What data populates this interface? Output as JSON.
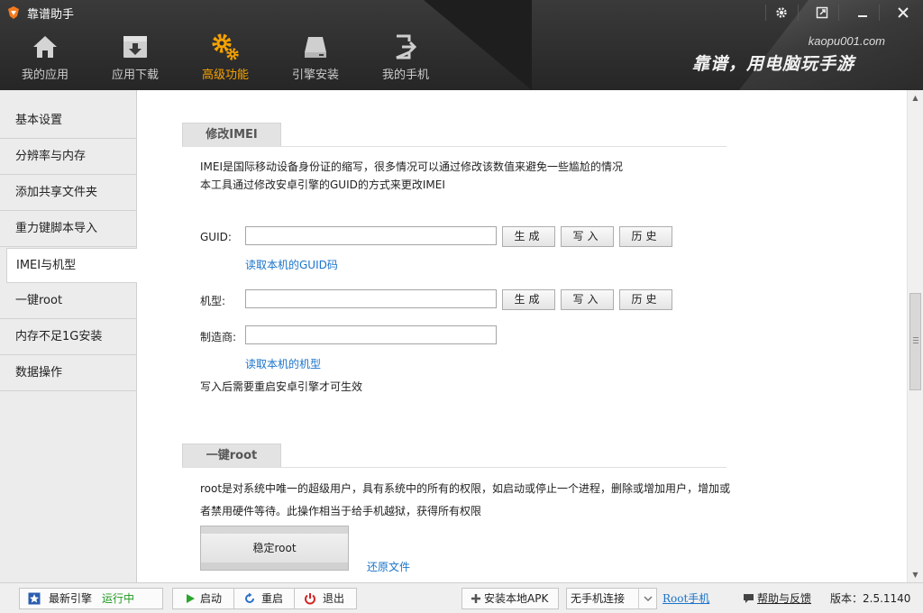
{
  "window": {
    "title": "靠谱助手",
    "settings_icon": "gear-icon",
    "restore_icon": "restore-icon",
    "minimize_icon": "minimize-icon",
    "close_icon": "close-icon"
  },
  "nav": [
    {
      "label": "我的应用",
      "icon": "home-icon"
    },
    {
      "label": "应用下载",
      "icon": "download-box-icon"
    },
    {
      "label": "高级功能",
      "icon": "gears-icon",
      "active": true
    },
    {
      "label": "引擎安装",
      "icon": "disk-drive-icon"
    },
    {
      "label": "我的手机",
      "icon": "exit-phone-icon"
    }
  ],
  "branding": {
    "url": "kaopu001.com",
    "slogan": "靠谱，用电脑玩手游"
  },
  "colors": {
    "accent": "#f7a200",
    "link": "#1a73c9",
    "running": "#1f9a1f"
  },
  "sidebar": [
    {
      "label": "基本设置"
    },
    {
      "label": "分辨率与内存"
    },
    {
      "label": "添加共享文件夹"
    },
    {
      "label": "重力键脚本导入"
    },
    {
      "label": "IMEI与机型",
      "active": true
    },
    {
      "label": "一键root"
    },
    {
      "label": "内存不足1G安装"
    },
    {
      "label": "数据操作"
    }
  ],
  "imei_section": {
    "title": "修改IMEI",
    "desc1": "IMEI是国际移动设备身份证的缩写，很多情况可以通过修改该数值来避免一些尴尬的情况",
    "desc2": "本工具通过修改安卓引擎的GUID的方式来更改IMEI",
    "guid_label": "GUID:",
    "guid_value": "",
    "model_label": "机型:",
    "model_value": "",
    "maker_label": "制造商:",
    "maker_value": "",
    "generate": "生成",
    "write": "写入",
    "history": "历史",
    "read_guid_link": "读取本机的GUID码",
    "read_model_link": "读取本机的机型",
    "note": "写入后需要重启安卓引擎才可生效"
  },
  "root_section": {
    "title": "一键root",
    "desc1": "root是对系统中唯一的超级用户，具有系统中的所有的权限，如启动或停止一个进程，删除或增加用户，增加或",
    "desc2": "者禁用硬件等待。此操作相当于给手机越狱，获得所有权限",
    "stable_root_button": "稳定root",
    "restore_link": "还原文件"
  },
  "statusbar": {
    "engine_label": "最新引擎",
    "engine_status": "运行中",
    "start": "启动",
    "restart": "重启",
    "exit": "退出",
    "install_apk": "安装本地APK",
    "phone_select": "无手机连接",
    "root_phone": "Root手机",
    "help": "帮助与反馈",
    "version_label": "版本：",
    "version": "2.5.1140"
  }
}
